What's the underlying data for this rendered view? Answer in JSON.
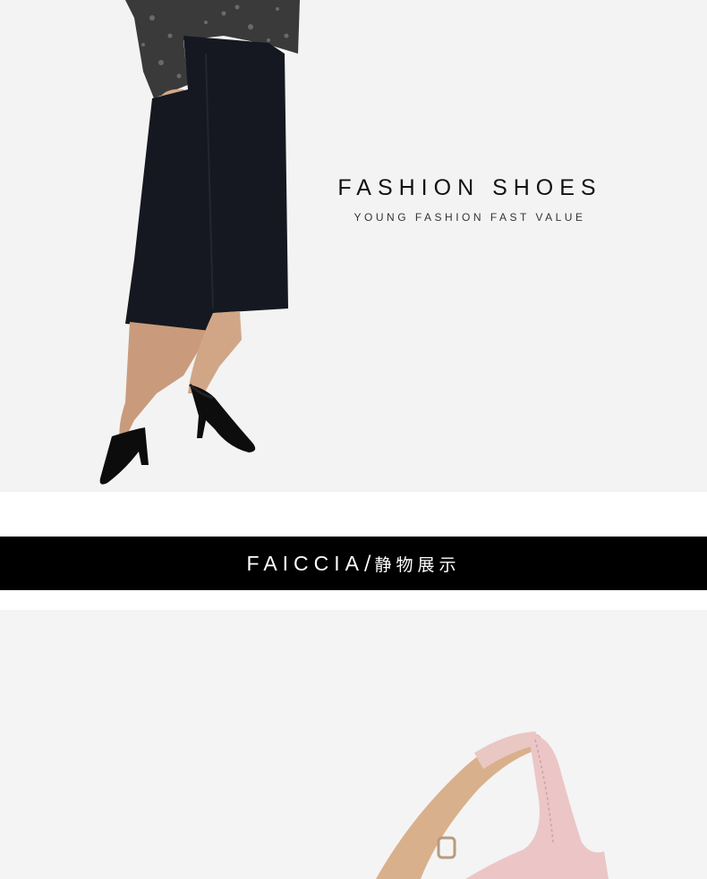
{
  "hero": {
    "title": "FASHION SHOES",
    "subtitle": "YOUNG FASHION FAST VALUE",
    "image": "model-wearing-black-slingback-heels"
  },
  "banner": {
    "brand": "FAICCIA",
    "separator": "/",
    "section_label": "静物展示"
  },
  "product": {
    "image": "pink-slingback-shoe-detail"
  },
  "colors": {
    "background": "#f3f3f3",
    "banner": "#000000",
    "text": "#111111"
  }
}
